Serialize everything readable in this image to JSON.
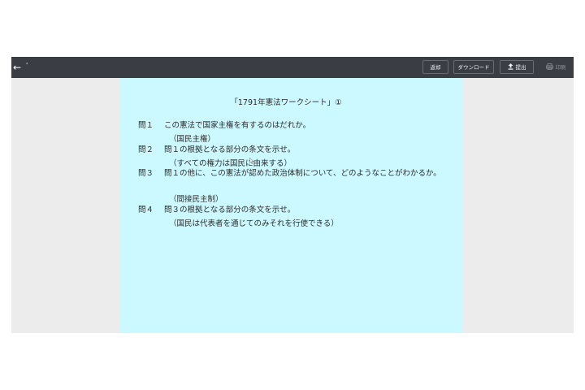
{
  "toolbar": {
    "back_icon": "arrow-left-icon",
    "back_glyph": "←",
    "title": "'",
    "reply_label": "返却",
    "download_label": "ダウンロード",
    "submit_icon": "upload-icon",
    "submit_label": "提出",
    "print_icon": "print-icon",
    "print_label": "印刷"
  },
  "worksheet": {
    "background_color": "#ccf9ff",
    "title": "「1791年憲法ワークシート」①",
    "questions": [
      {
        "number": "問１",
        "text": "この憲法で国家主権を有するのはだれか。",
        "answer": "（国民主権）"
      },
      {
        "number": "問２",
        "text": "問１の根拠となる部分の条文を示せ。",
        "answer": "（すべての権力は国民に由来する）"
      },
      {
        "number": "問３",
        "text": "問１の他に、この憲法が認めた政治体制について、どのようなことがわかるか。",
        "answer": "（間接民主制）"
      },
      {
        "number": "問４",
        "text": "問３の根拠となる部分の条文を示せ。",
        "answer": "（国民は代表者を通じてのみそれを行使できる）"
      }
    ]
  }
}
